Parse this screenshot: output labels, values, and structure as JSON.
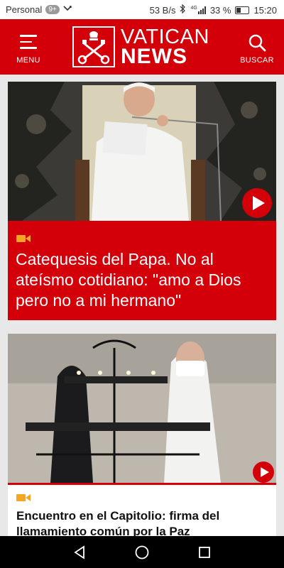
{
  "status_bar": {
    "carrier": "Personal",
    "notification_badge": "9+",
    "speed": "53 B/s",
    "network": "4G",
    "battery": "33 %",
    "time": "15:20"
  },
  "header": {
    "menu_label": "MENU",
    "logo_line1": "VATICAN",
    "logo_line2": "NEWS",
    "search_label": "BUSCAR"
  },
  "articles": [
    {
      "category_icon": "video-camera-icon",
      "title": "Catequesis del Papa. No al ateísmo cotidiano: \"amo a Dios pero no a mi hermano\""
    },
    {
      "category_icon": "video-camera-icon",
      "title": "Encuentro en el Capitolio: firma del llamamiento común por la Paz"
    }
  ],
  "colors": {
    "brand_red": "#d40009",
    "accent_orange": "#f5a623"
  }
}
